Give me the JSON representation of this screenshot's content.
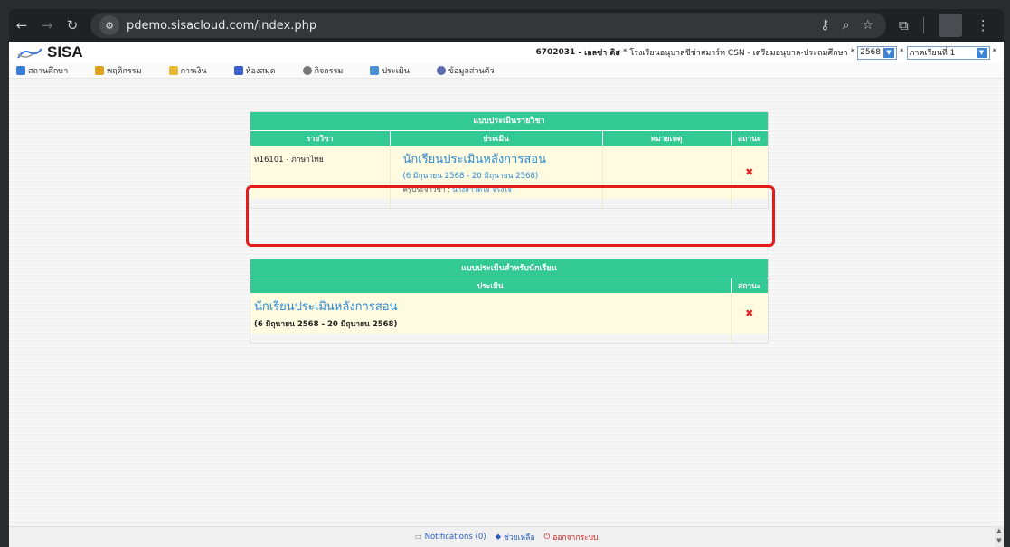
{
  "browser": {
    "url": "pdemo.sisacloud.com/index.php"
  },
  "header": {
    "logo_text": "SISA",
    "student_id": "6702031",
    "student_name": " - เอลซ่า ดิส",
    "school": "โรงเรียนอนุบาลชีช่าสมาร์ท CSN - เตรียมอนุบาล-ประถมศึกษา",
    "year_value": "2568",
    "term_value": "ภาคเรียนที่ 1"
  },
  "menu": [
    {
      "label": "สถานศึกษา",
      "icon": "home-icon",
      "color": "#3a7bd5"
    },
    {
      "label": "พฤติกรรม",
      "icon": "behavior-icon",
      "color": "#e0a020"
    },
    {
      "label": "การเงิน",
      "icon": "finance-icon",
      "color": "#e8b830"
    },
    {
      "label": "ห้องสมุด",
      "icon": "library-icon",
      "color": "#3a5fcd"
    },
    {
      "label": "กิจกรรม",
      "icon": "activity-icon",
      "color": "#777777"
    },
    {
      "label": "ประเมิน",
      "icon": "evaluation-icon",
      "color": "#4a90d9"
    },
    {
      "label": "ข้อมูลส่วนตัว",
      "icon": "profile-icon",
      "color": "#5a6bb0"
    }
  ],
  "subject_eval": {
    "title": "แบบประเมินรายวิชา",
    "columns": [
      "รายวิชา",
      "ประเมิน",
      "หมายเหตุ",
      "สถานะ"
    ],
    "row": {
      "subject": "ท16101 - ภาษาไทย",
      "eval_title": "นักเรียนประเมินหลังการสอน",
      "eval_dates": "(6 มิถุนายน 2568 - 20 มิถุนายน 2568)",
      "teacher_label": "ครูประจำวิชา : ",
      "teacher_name": "นางสาวดีใจ จริงใจ",
      "note": "",
      "status": "✖"
    }
  },
  "student_eval": {
    "title": "แบบประเมินสำหรับนักเรียน",
    "columns": [
      "ประเมิน",
      "สถานะ"
    ],
    "row": {
      "eval_title": "นักเรียนประเมินหลังการสอน",
      "eval_dates": "(6 มิถุนายน 2568 - 20 มิถุนายน 2568)",
      "status": "✖"
    }
  },
  "footer": {
    "notifications": "Notifications (0)",
    "help": "ช่วยเหลือ",
    "logout": "ออกจากระบบ"
  }
}
